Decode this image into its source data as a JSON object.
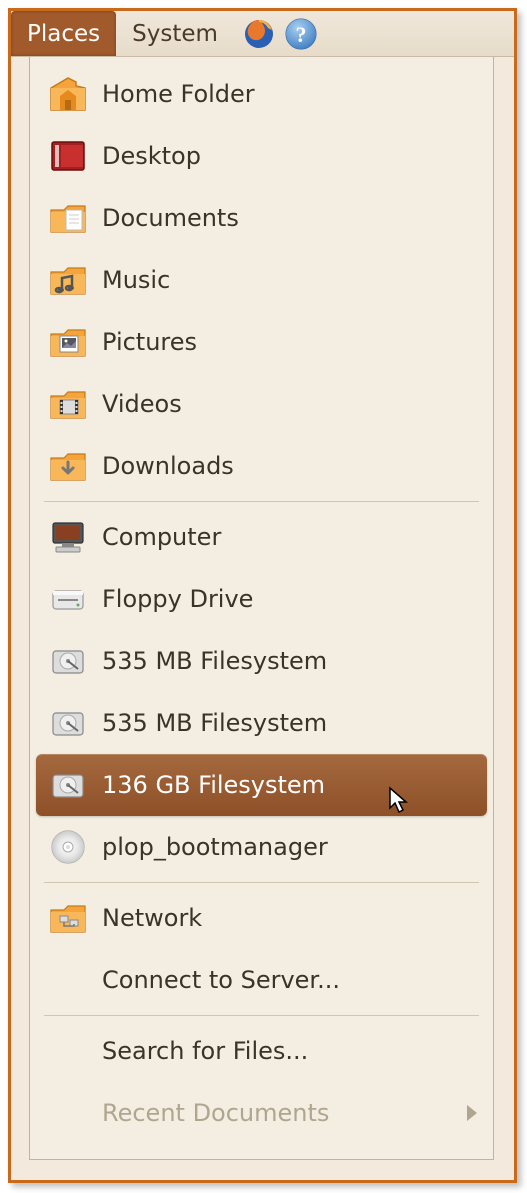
{
  "panel": {
    "places_label": "Places",
    "system_label": "System"
  },
  "menu": {
    "home": "Home Folder",
    "desktop": "Desktop",
    "documents": "Documents",
    "music": "Music",
    "pictures": "Pictures",
    "videos": "Videos",
    "downloads": "Downloads",
    "computer": "Computer",
    "floppy": "Floppy Drive",
    "fs1": "535 MB Filesystem",
    "fs2": "535 MB Filesystem",
    "fs3": "136 GB Filesystem",
    "plop": "plop_bootmanager",
    "network": "Network",
    "connect": "Connect to Server...",
    "search": "Search for Files...",
    "recent": "Recent Documents"
  },
  "selected_index": 11
}
